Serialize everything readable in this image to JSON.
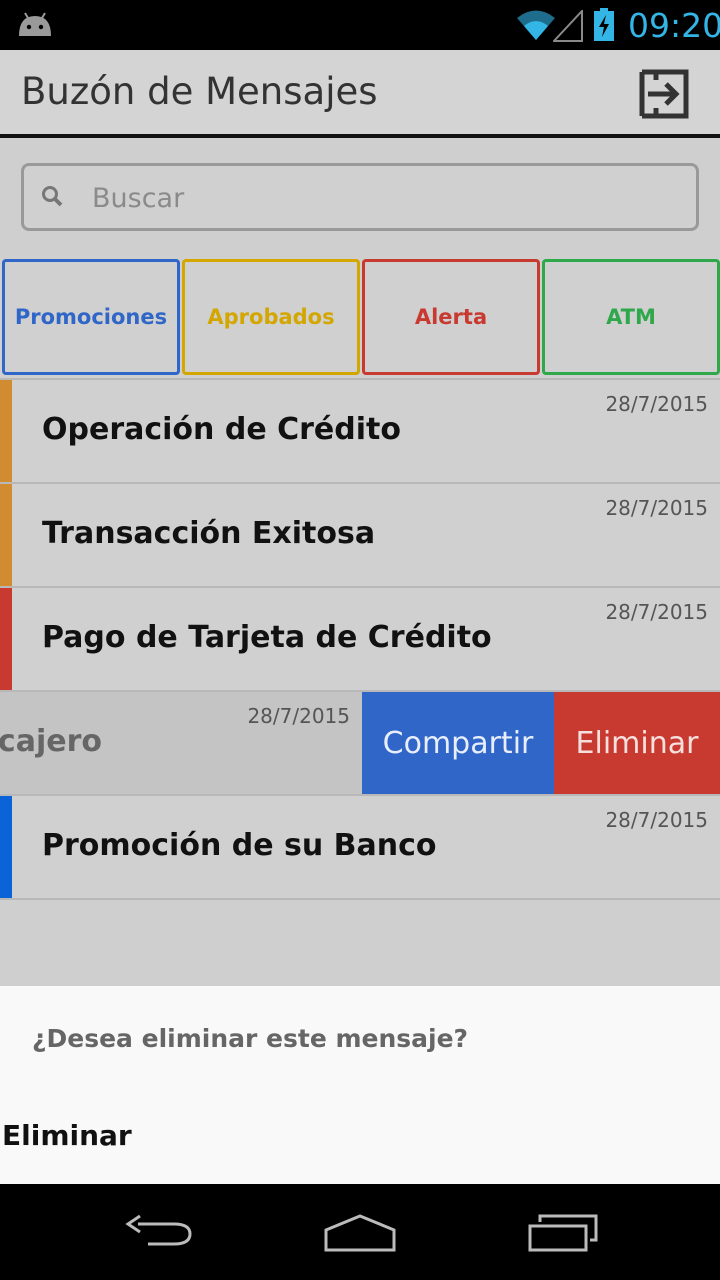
{
  "status_bar": {
    "time": "09:20",
    "time_color": "#33b5e5"
  },
  "app_bar": {
    "title": "Buzón de Mensajes",
    "exit_icon": "exit-to-app-icon"
  },
  "search": {
    "placeholder": "Buscar",
    "value": ""
  },
  "filters": [
    {
      "label": "Promociones",
      "color": "#2f66c8"
    },
    {
      "label": "Aprobados",
      "color": "#d4a600"
    },
    {
      "label": "Alerta",
      "color": "#c83a30"
    },
    {
      "label": "ATM",
      "color": "#2ea84a"
    }
  ],
  "messages": [
    {
      "title": "Operación de Crédito",
      "date": "28/7/2015",
      "accent": "#d18b30"
    },
    {
      "title": "Transacción Exitosa",
      "date": "28/7/2015",
      "accent": "#d18b30"
    },
    {
      "title": "Pago de Tarjeta de Crédito",
      "date": "28/7/2015",
      "accent": "#c83a30"
    },
    {
      "title": "e cajero",
      "date": "28/7/2015",
      "accent": ""
    },
    {
      "title": "Promoción de su Banco",
      "date": "28/7/2015",
      "accent": "#0a64d8"
    }
  ],
  "swipe_actions": {
    "share_label": "Compartir",
    "delete_label": "Eliminar",
    "share_color": "#2f66c8",
    "delete_color": "#c83a30"
  },
  "dialog": {
    "question": "¿Desea eliminar este mensaje?",
    "action_label": "Eliminar"
  }
}
